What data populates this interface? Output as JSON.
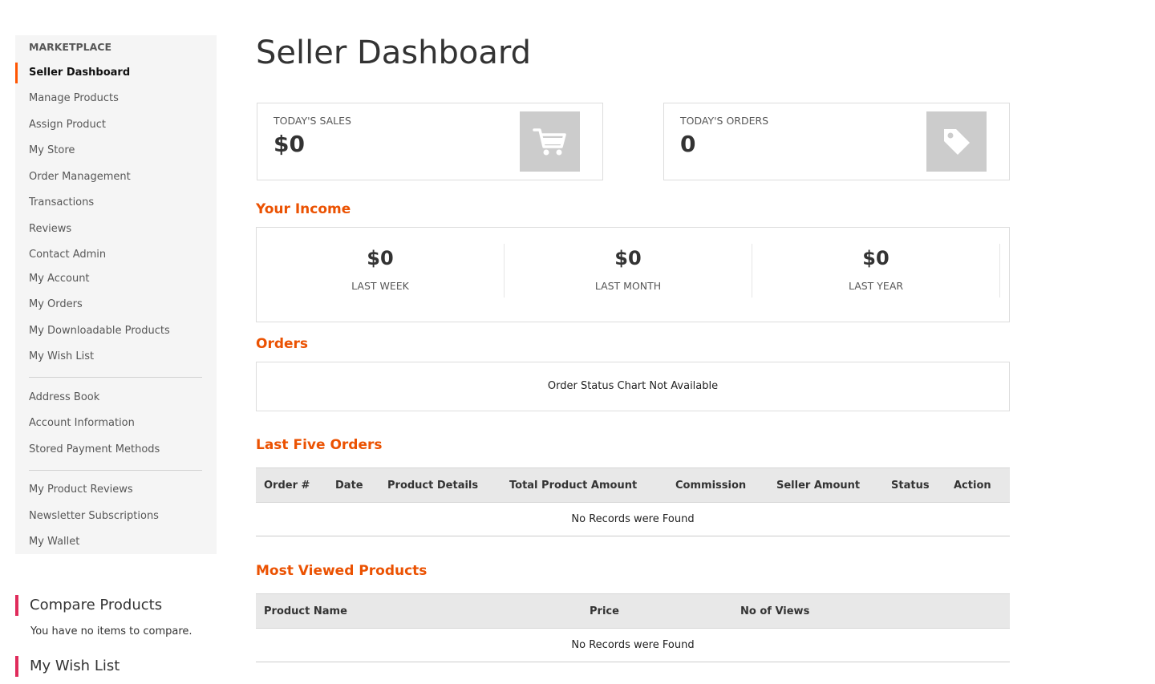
{
  "sidebar": {
    "heading": "MARKETPLACE",
    "items": [
      {
        "label": "Seller Dashboard",
        "active": true
      },
      {
        "label": "Manage Products"
      },
      {
        "label": "Assign Product"
      },
      {
        "label": "My Store"
      },
      {
        "label": "Order Management"
      },
      {
        "label": "Transactions"
      },
      {
        "label": "Reviews"
      },
      {
        "label": "Contact Admin"
      },
      {
        "label": "My Account"
      },
      {
        "label": "My Orders"
      },
      {
        "label": "My Downloadable Products"
      },
      {
        "label": "My Wish List"
      },
      {
        "label": "Address Book"
      },
      {
        "label": "Account Information"
      },
      {
        "label": "Stored Payment Methods"
      },
      {
        "label": "My Product Reviews"
      },
      {
        "label": "Newsletter Subscriptions"
      },
      {
        "label": "My Wallet"
      }
    ]
  },
  "compare": {
    "title": "Compare Products",
    "text": "You have no items to compare."
  },
  "wishlist": {
    "title": "My Wish List"
  },
  "main": {
    "title": "Seller Dashboard",
    "todays_sales": {
      "label": "TODAY'S SALES",
      "value": "$0",
      "icon": "cart-icon"
    },
    "todays_orders": {
      "label": "TODAY'S ORDERS",
      "value": "0",
      "icon": "tag-icon"
    },
    "income": {
      "title": "Your Income",
      "cols": [
        {
          "value": "$0",
          "label": "LAST WEEK"
        },
        {
          "value": "$0",
          "label": "LAST MONTH"
        },
        {
          "value": "$0",
          "label": "LAST YEAR"
        }
      ]
    },
    "orders": {
      "title": "Orders",
      "message": "Order Status Chart Not Available"
    },
    "last_five_orders": {
      "title": "Last Five Orders",
      "columns": [
        "Order #",
        "Date",
        "Product Details",
        "Total Product Amount",
        "Commission",
        "Seller Amount",
        "Status",
        "Action"
      ],
      "empty": "No Records were Found"
    },
    "most_viewed": {
      "title": "Most Viewed Products",
      "columns": [
        "Product Name",
        "Price",
        "No of Views"
      ],
      "empty": "No Records were Found"
    }
  },
  "colors": {
    "accent": "#eb5202",
    "active_marker": "#ff5501",
    "block_marker": "#e02b5b"
  }
}
